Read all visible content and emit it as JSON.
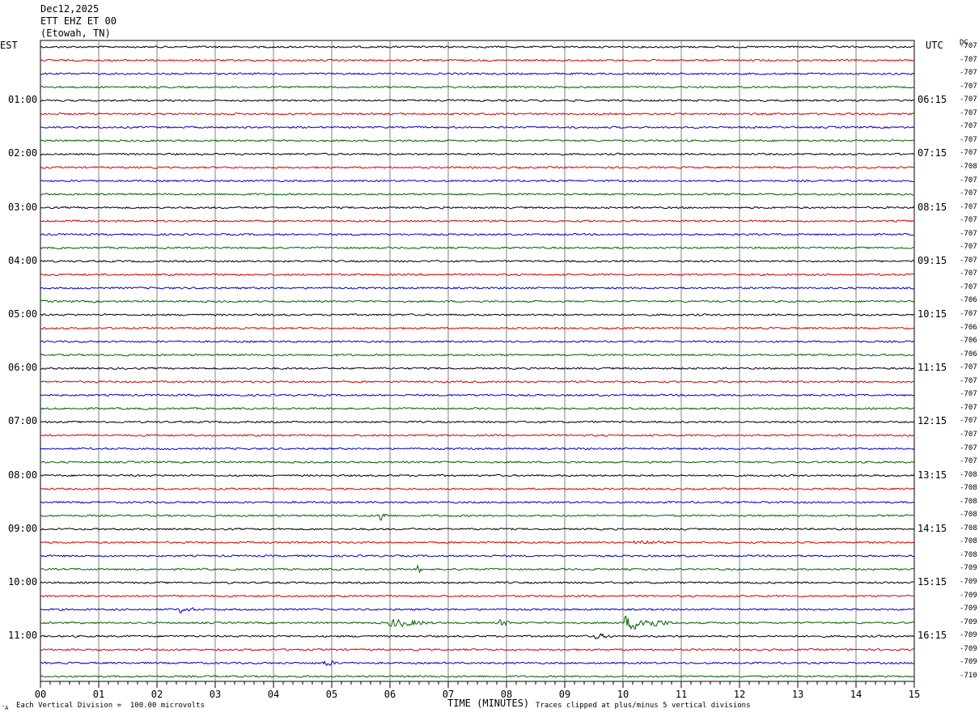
{
  "header": {
    "date": "Dec12,2025",
    "station": "ETT EHZ ET 00",
    "location": "(Etowah, TN)"
  },
  "left_zone_label": "EST",
  "right_zone_label": "UTC",
  "dc_header": "DC",
  "footer": {
    "scale_note": "Each Vertical Division =  100.00 microvolts",
    "clip_note": "Traces clipped at plus/minus 5 vertical divisions",
    "corner_mark": "‘A"
  },
  "colors": {
    "trace_cycle": [
      "#000000",
      "#d40000",
      "#0000c8",
      "#006400"
    ],
    "grid": "#808080"
  },
  "chart_data": {
    "type": "line",
    "xlabel": "TIME (MINUTES)",
    "xlim": [
      0,
      15
    ],
    "x_ticks": [
      "00",
      "01",
      "02",
      "03",
      "04",
      "05",
      "06",
      "07",
      "08",
      "09",
      "10",
      "11",
      "12",
      "13",
      "14",
      "15"
    ],
    "rows": 48,
    "left_time_labels": [
      {
        "row": 4,
        "text": "01:00"
      },
      {
        "row": 8,
        "text": "02:00"
      },
      {
        "row": 12,
        "text": "03:00"
      },
      {
        "row": 16,
        "text": "04:00"
      },
      {
        "row": 20,
        "text": "05:00"
      },
      {
        "row": 24,
        "text": "06:00"
      },
      {
        "row": 28,
        "text": "07:00"
      },
      {
        "row": 32,
        "text": "08:00"
      },
      {
        "row": 36,
        "text": "09:00"
      },
      {
        "row": 40,
        "text": "10:00"
      },
      {
        "row": 44,
        "text": "11:00"
      }
    ],
    "right_time_labels": [
      {
        "row": 4,
        "text": "06:15"
      },
      {
        "row": 8,
        "text": "07:15"
      },
      {
        "row": 12,
        "text": "08:15"
      },
      {
        "row": 16,
        "text": "09:15"
      },
      {
        "row": 20,
        "text": "10:15"
      },
      {
        "row": 24,
        "text": "11:15"
      },
      {
        "row": 28,
        "text": "12:15"
      },
      {
        "row": 32,
        "text": "13:15"
      },
      {
        "row": 36,
        "text": "14:15"
      },
      {
        "row": 40,
        "text": "15:15"
      },
      {
        "row": 44,
        "text": "16:15"
      }
    ],
    "dc_offsets": [
      "-707",
      "-707",
      "-707",
      "-707",
      "-707",
      "-707",
      "-707",
      "-707",
      "-707",
      "-708",
      "-707",
      "-707",
      "-707",
      "-707",
      "-707",
      "-707",
      "-707",
      "-707",
      "-707",
      "-706",
      "-707",
      "-706",
      "-706",
      "-706",
      "-707",
      "-707",
      "-707",
      "-707",
      "-707",
      "-707",
      "-707",
      "-707",
      "-708",
      "-708",
      "-708",
      "-708",
      "-708",
      "-708",
      "-708",
      "-709",
      "-709",
      "-709",
      "-709",
      "-709",
      "-709",
      "-709",
      "-709",
      "-710"
    ],
    "events": [
      {
        "row": 35,
        "minute": 5.85,
        "amplitude": 9,
        "duration": 0.12
      },
      {
        "row": 37,
        "minute": 10.2,
        "amplitude": 3,
        "duration": 0.5
      },
      {
        "row": 39,
        "minute": 6.48,
        "amplitude": 6,
        "duration": 0.08
      },
      {
        "row": 42,
        "minute": 2.4,
        "amplitude": 4,
        "duration": 0.3
      },
      {
        "row": 43,
        "minute": 6.0,
        "amplitude": 5,
        "duration": 0.8
      },
      {
        "row": 43,
        "minute": 7.9,
        "amplitude": 4,
        "duration": 0.2
      },
      {
        "row": 43,
        "minute": 10.05,
        "amplitude": 9,
        "duration": 0.9
      },
      {
        "row": 44,
        "minute": 9.5,
        "amplitude": 3,
        "duration": 0.4
      },
      {
        "row": 46,
        "minute": 4.85,
        "amplitude": 4,
        "duration": 0.3
      }
    ]
  }
}
